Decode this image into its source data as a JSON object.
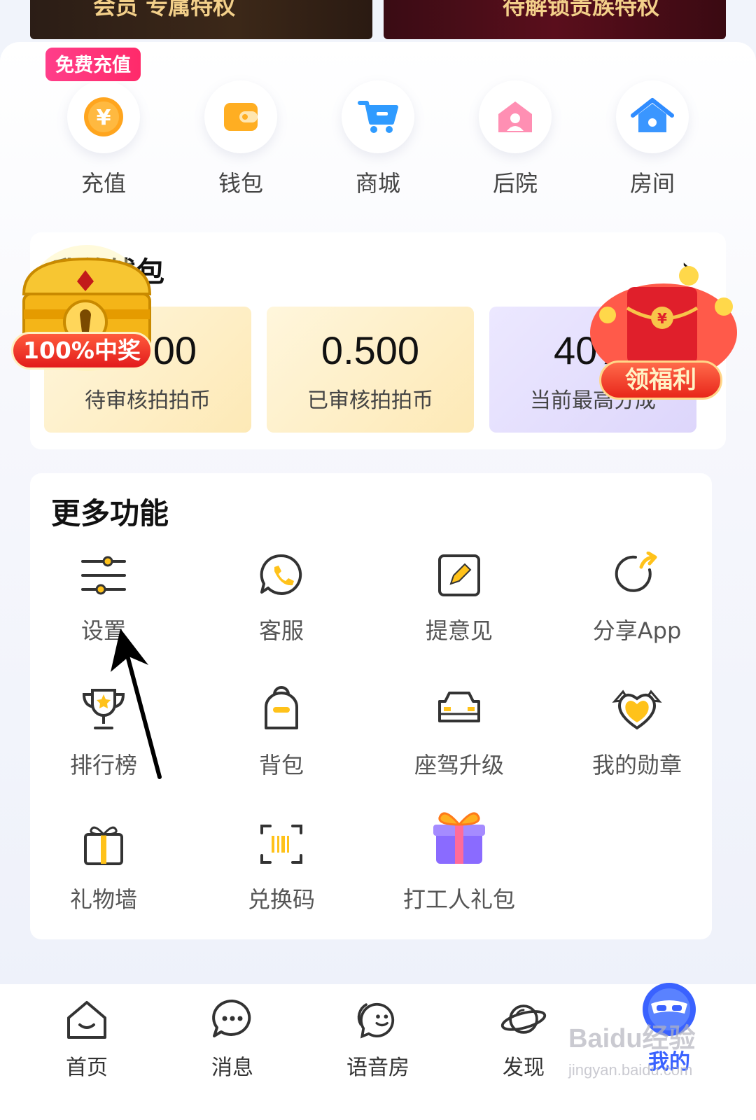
{
  "banners": {
    "left_text": "会员    专属特权",
    "right_text": "待解锁贵族特权"
  },
  "quick_actions": {
    "free_badge": "免费充值",
    "items": [
      {
        "label": "充值",
        "icon": "yuan-coin-icon"
      },
      {
        "label": "钱包",
        "icon": "wallet-icon"
      },
      {
        "label": "商城",
        "icon": "cart-icon"
      },
      {
        "label": "后院",
        "icon": "backyard-icon"
      },
      {
        "label": "房间",
        "icon": "house-icon"
      }
    ]
  },
  "wallet": {
    "title": "我的钱包",
    "chevron": "›",
    "stats": [
      {
        "value": "0.000",
        "label": "待审核拍拍币"
      },
      {
        "value": "0.500",
        "label": "已审核拍拍币"
      },
      {
        "value": "40%",
        "label": "当前最高分成"
      }
    ]
  },
  "promos": {
    "prize_tag": "100%中奖",
    "benefit_tag": "领福利"
  },
  "more": {
    "title": "更多功能",
    "features": [
      {
        "label": "设置",
        "icon": "settings-sliders-icon"
      },
      {
        "label": "客服",
        "icon": "customer-service-icon"
      },
      {
        "label": "提意见",
        "icon": "feedback-edit-icon"
      },
      {
        "label": "分享App",
        "icon": "share-icon"
      },
      {
        "label": "排行榜",
        "icon": "trophy-icon"
      },
      {
        "label": "背包",
        "icon": "backpack-icon"
      },
      {
        "label": "座驾升级",
        "icon": "car-icon"
      },
      {
        "label": "我的勋章",
        "icon": "medal-heart-icon"
      },
      {
        "label": "礼物墙",
        "icon": "gift-icon"
      },
      {
        "label": "兑换码",
        "icon": "barcode-icon"
      },
      {
        "label": "打工人礼包",
        "icon": "gift-box-icon"
      }
    ]
  },
  "nav": {
    "items": [
      {
        "label": "首页",
        "icon": "home-icon"
      },
      {
        "label": "消息",
        "icon": "message-icon"
      },
      {
        "label": "语音房",
        "icon": "voice-room-icon"
      },
      {
        "label": "发现",
        "icon": "planet-icon"
      },
      {
        "label": "我的",
        "icon": "profile-avatar-icon"
      }
    ]
  },
  "watermark": {
    "main": "Baidu经验",
    "sub": "jingyan.baidu.com"
  },
  "colors": {
    "accent_blue": "#3a62ff",
    "badge_pink": "#ff2a6a",
    "gold": "#f5b800"
  }
}
